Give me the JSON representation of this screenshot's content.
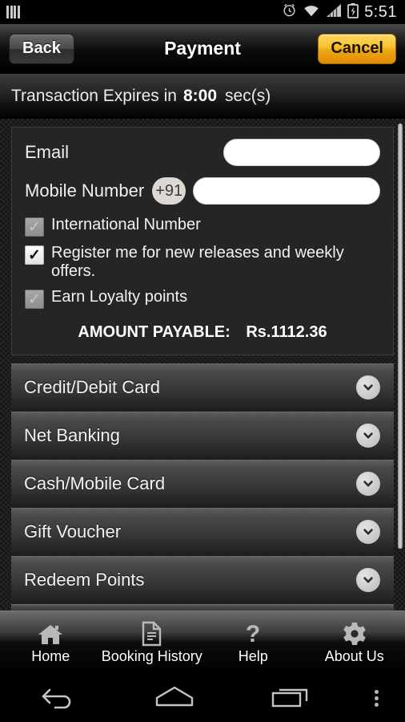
{
  "statusbar": {
    "left_icon": "signal-bars-icon",
    "icons": [
      "alarm-icon",
      "wifi-icon",
      "cellular-signal-icon",
      "battery-charging-icon"
    ],
    "time": "5:51"
  },
  "titlebar": {
    "back_label": "Back",
    "title": "Payment",
    "cancel_label": "Cancel",
    "cancel_color": "#f6c32f"
  },
  "expiry": {
    "prefix": "Transaction Expires in",
    "timer": "8:00",
    "unit": "sec(s)"
  },
  "form": {
    "email": {
      "label": "Email",
      "value": "",
      "placeholder": ""
    },
    "mobile": {
      "label": "Mobile Number",
      "country_code": "+91",
      "value": "",
      "placeholder": ""
    },
    "checkboxes": [
      {
        "label": "International Number",
        "checked": false
      },
      {
        "label": "Register me for new releases and weekly offers.",
        "checked": true
      },
      {
        "label": "Earn Loyalty points",
        "checked": false
      }
    ],
    "amount_label": "AMOUNT PAYABLE:",
    "amount_value": "Rs.1112.36"
  },
  "payment_methods": [
    {
      "label": "Credit/Debit Card",
      "expand_icon": "chevron-down-icon"
    },
    {
      "label": "Net Banking",
      "expand_icon": "chevron-down-icon"
    },
    {
      "label": "Cash/Mobile Card",
      "expand_icon": "chevron-down-icon"
    },
    {
      "label": "Gift Voucher",
      "expand_icon": "chevron-down-icon"
    },
    {
      "label": "Redeem Points",
      "expand_icon": "chevron-down-icon"
    }
  ],
  "tabbar": [
    {
      "label": "Home",
      "icon": "home-icon"
    },
    {
      "label": "Booking History",
      "icon": "document-icon"
    },
    {
      "label": "Help",
      "icon": "question-mark-icon"
    },
    {
      "label": "About Us",
      "icon": "gear-icon"
    }
  ],
  "navbar": [
    {
      "icon": "back-arrow-icon"
    },
    {
      "icon": "home-pentagon-icon"
    },
    {
      "icon": "recents-icon"
    },
    {
      "icon": "overflow-menu-icon"
    }
  ]
}
